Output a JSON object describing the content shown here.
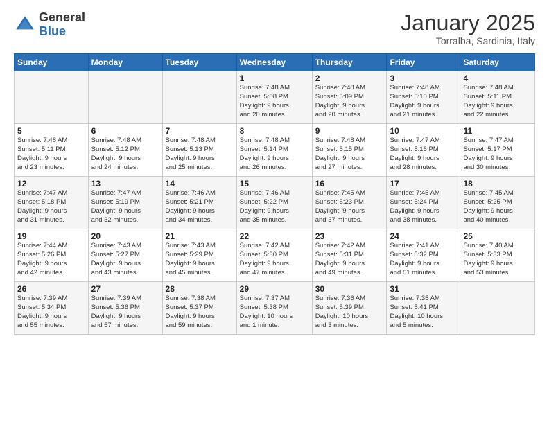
{
  "logo": {
    "general": "General",
    "blue": "Blue"
  },
  "header": {
    "month": "January 2025",
    "location": "Torralba, Sardinia, Italy"
  },
  "weekdays": [
    "Sunday",
    "Monday",
    "Tuesday",
    "Wednesday",
    "Thursday",
    "Friday",
    "Saturday"
  ],
  "weeks": [
    [
      {
        "day": "",
        "info": ""
      },
      {
        "day": "",
        "info": ""
      },
      {
        "day": "",
        "info": ""
      },
      {
        "day": "1",
        "info": "Sunrise: 7:48 AM\nSunset: 5:08 PM\nDaylight: 9 hours\nand 20 minutes."
      },
      {
        "day": "2",
        "info": "Sunrise: 7:48 AM\nSunset: 5:09 PM\nDaylight: 9 hours\nand 20 minutes."
      },
      {
        "day": "3",
        "info": "Sunrise: 7:48 AM\nSunset: 5:10 PM\nDaylight: 9 hours\nand 21 minutes."
      },
      {
        "day": "4",
        "info": "Sunrise: 7:48 AM\nSunset: 5:11 PM\nDaylight: 9 hours\nand 22 minutes."
      }
    ],
    [
      {
        "day": "5",
        "info": "Sunrise: 7:48 AM\nSunset: 5:11 PM\nDaylight: 9 hours\nand 23 minutes."
      },
      {
        "day": "6",
        "info": "Sunrise: 7:48 AM\nSunset: 5:12 PM\nDaylight: 9 hours\nand 24 minutes."
      },
      {
        "day": "7",
        "info": "Sunrise: 7:48 AM\nSunset: 5:13 PM\nDaylight: 9 hours\nand 25 minutes."
      },
      {
        "day": "8",
        "info": "Sunrise: 7:48 AM\nSunset: 5:14 PM\nDaylight: 9 hours\nand 26 minutes."
      },
      {
        "day": "9",
        "info": "Sunrise: 7:48 AM\nSunset: 5:15 PM\nDaylight: 9 hours\nand 27 minutes."
      },
      {
        "day": "10",
        "info": "Sunrise: 7:47 AM\nSunset: 5:16 PM\nDaylight: 9 hours\nand 28 minutes."
      },
      {
        "day": "11",
        "info": "Sunrise: 7:47 AM\nSunset: 5:17 PM\nDaylight: 9 hours\nand 30 minutes."
      }
    ],
    [
      {
        "day": "12",
        "info": "Sunrise: 7:47 AM\nSunset: 5:18 PM\nDaylight: 9 hours\nand 31 minutes."
      },
      {
        "day": "13",
        "info": "Sunrise: 7:47 AM\nSunset: 5:19 PM\nDaylight: 9 hours\nand 32 minutes."
      },
      {
        "day": "14",
        "info": "Sunrise: 7:46 AM\nSunset: 5:21 PM\nDaylight: 9 hours\nand 34 minutes."
      },
      {
        "day": "15",
        "info": "Sunrise: 7:46 AM\nSunset: 5:22 PM\nDaylight: 9 hours\nand 35 minutes."
      },
      {
        "day": "16",
        "info": "Sunrise: 7:45 AM\nSunset: 5:23 PM\nDaylight: 9 hours\nand 37 minutes."
      },
      {
        "day": "17",
        "info": "Sunrise: 7:45 AM\nSunset: 5:24 PM\nDaylight: 9 hours\nand 38 minutes."
      },
      {
        "day": "18",
        "info": "Sunrise: 7:45 AM\nSunset: 5:25 PM\nDaylight: 9 hours\nand 40 minutes."
      }
    ],
    [
      {
        "day": "19",
        "info": "Sunrise: 7:44 AM\nSunset: 5:26 PM\nDaylight: 9 hours\nand 42 minutes."
      },
      {
        "day": "20",
        "info": "Sunrise: 7:43 AM\nSunset: 5:27 PM\nDaylight: 9 hours\nand 43 minutes."
      },
      {
        "day": "21",
        "info": "Sunrise: 7:43 AM\nSunset: 5:29 PM\nDaylight: 9 hours\nand 45 minutes."
      },
      {
        "day": "22",
        "info": "Sunrise: 7:42 AM\nSunset: 5:30 PM\nDaylight: 9 hours\nand 47 minutes."
      },
      {
        "day": "23",
        "info": "Sunrise: 7:42 AM\nSunset: 5:31 PM\nDaylight: 9 hours\nand 49 minutes."
      },
      {
        "day": "24",
        "info": "Sunrise: 7:41 AM\nSunset: 5:32 PM\nDaylight: 9 hours\nand 51 minutes."
      },
      {
        "day": "25",
        "info": "Sunrise: 7:40 AM\nSunset: 5:33 PM\nDaylight: 9 hours\nand 53 minutes."
      }
    ],
    [
      {
        "day": "26",
        "info": "Sunrise: 7:39 AM\nSunset: 5:34 PM\nDaylight: 9 hours\nand 55 minutes."
      },
      {
        "day": "27",
        "info": "Sunrise: 7:39 AM\nSunset: 5:36 PM\nDaylight: 9 hours\nand 57 minutes."
      },
      {
        "day": "28",
        "info": "Sunrise: 7:38 AM\nSunset: 5:37 PM\nDaylight: 9 hours\nand 59 minutes."
      },
      {
        "day": "29",
        "info": "Sunrise: 7:37 AM\nSunset: 5:38 PM\nDaylight: 10 hours\nand 1 minute."
      },
      {
        "day": "30",
        "info": "Sunrise: 7:36 AM\nSunset: 5:39 PM\nDaylight: 10 hours\nand 3 minutes."
      },
      {
        "day": "31",
        "info": "Sunrise: 7:35 AM\nSunset: 5:41 PM\nDaylight: 10 hours\nand 5 minutes."
      },
      {
        "day": "",
        "info": ""
      }
    ]
  ]
}
